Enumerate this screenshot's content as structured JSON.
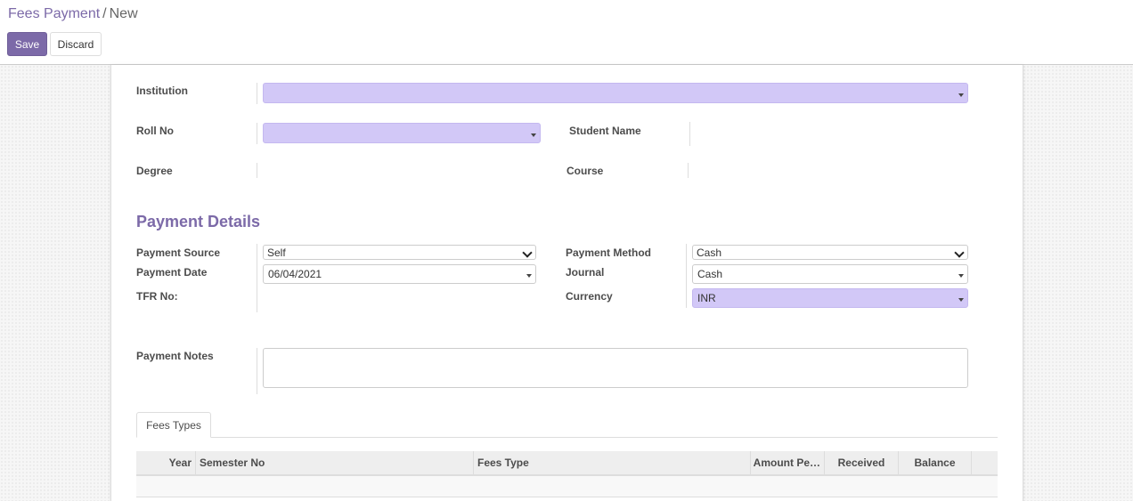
{
  "breadcrumb": {
    "parent": "Fees Payment",
    "separator": "/",
    "current": "New"
  },
  "buttons": {
    "save": "Save",
    "discard": "Discard"
  },
  "form": {
    "institution": {
      "label": "Institution",
      "value": ""
    },
    "roll_no": {
      "label": "Roll No",
      "value": ""
    },
    "student_name": {
      "label": "Student Name",
      "value": ""
    },
    "degree": {
      "label": "Degree",
      "value": ""
    },
    "course": {
      "label": "Course",
      "value": ""
    },
    "payment_section_title": "Payment Details",
    "payment_source": {
      "label": "Payment Source",
      "value": "Self"
    },
    "payment_date": {
      "label": "Payment Date",
      "value": "06/04/2021"
    },
    "tfr_no": {
      "label": "TFR No:",
      "value": ""
    },
    "payment_method": {
      "label": "Payment Method",
      "value": "Cash"
    },
    "journal": {
      "label": "Journal",
      "value": "Cash"
    },
    "currency": {
      "label": "Currency",
      "value": "INR"
    },
    "payment_notes": {
      "label": "Payment Notes",
      "value": ""
    }
  },
  "tabs": [
    {
      "label": "Fees Types",
      "active": true
    }
  ],
  "table": {
    "columns": [
      "Year",
      "Semester No",
      "Fees Type",
      "Amount Pe…",
      "Received",
      "Balance"
    ],
    "rows": []
  },
  "colors": {
    "brand": "#7c6aa8",
    "required_field": "#d2c8f7"
  }
}
